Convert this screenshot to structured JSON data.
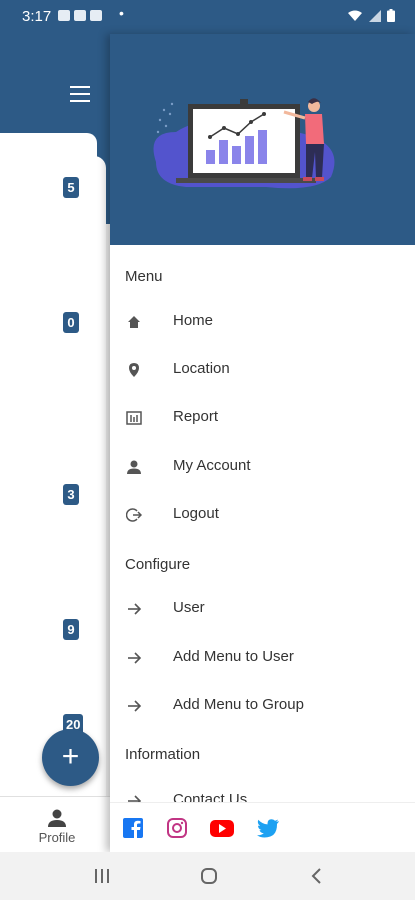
{
  "status_bar": {
    "time": "3:17",
    "dot": "•"
  },
  "background_app": {
    "counts": [
      "5",
      "0",
      "3",
      "9",
      "20"
    ],
    "fab_label": "+",
    "bottom_nav": {
      "profile_label": "Profile"
    }
  },
  "drawer": {
    "sections": [
      {
        "title": "Menu",
        "items": [
          {
            "label": "Home",
            "icon": "home-icon"
          },
          {
            "label": "Location",
            "icon": "location-pin-icon"
          },
          {
            "label": "Report",
            "icon": "report-icon"
          },
          {
            "label": "My Account",
            "icon": "person-icon"
          },
          {
            "label": "Logout",
            "icon": "logout-icon"
          }
        ]
      },
      {
        "title": "Configure",
        "items": [
          {
            "label": "User",
            "icon": "arrow-right-icon"
          },
          {
            "label": "Add Menu to User",
            "icon": "arrow-right-icon"
          },
          {
            "label": "Add Menu to Group",
            "icon": "arrow-right-icon"
          }
        ]
      },
      {
        "title": "Information",
        "items": [
          {
            "label": "Contact Us",
            "icon": "arrow-right-icon"
          }
        ]
      }
    ],
    "social": [
      "facebook-icon",
      "instagram-icon",
      "youtube-icon",
      "twitter-icon"
    ]
  },
  "colors": {
    "primary": "#2d5a86",
    "facebook": "#1877f2",
    "instagram": "#c13584",
    "youtube": "#ff0000",
    "twitter": "#1da1f2"
  }
}
